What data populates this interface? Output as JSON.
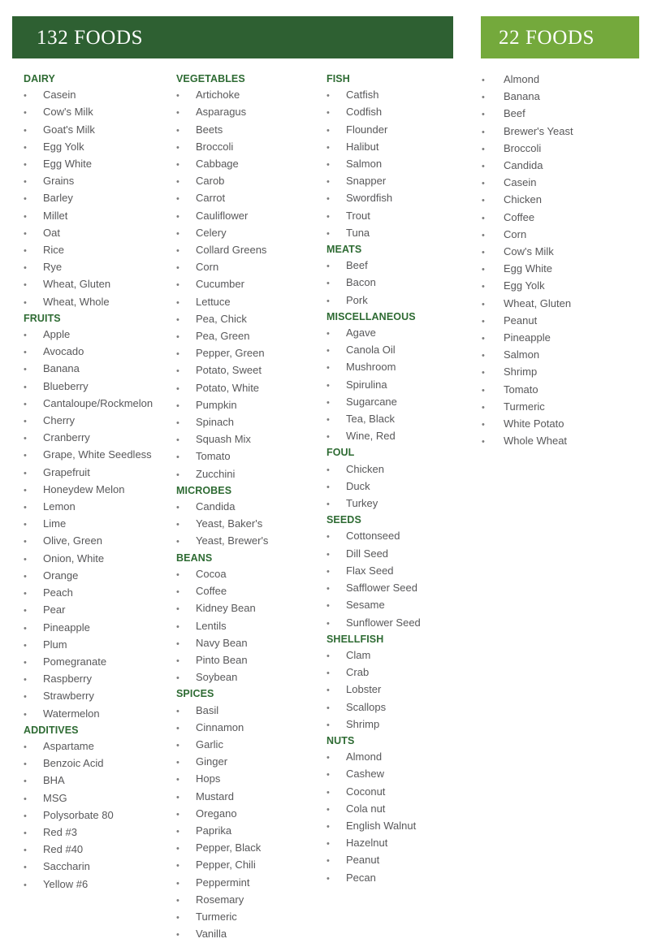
{
  "headers": {
    "primary": {
      "title": "132 FOODS",
      "color": "#2e6032"
    },
    "secondary": {
      "title": "22 FOODS",
      "color": "#74a93c"
    }
  },
  "bullet_glyph": "•",
  "heading_color": "#2e6b33",
  "item_color": "#58585a",
  "panel_132": {
    "columns": [
      {
        "sections": [
          {
            "heading": "DAIRY",
            "items": [
              "Casein",
              "Cow's Milk",
              "Goat's Milk",
              "Egg Yolk",
              "Egg White",
              "Grains",
              "Barley",
              "Millet",
              "Oat",
              "Rice",
              "Rye",
              "Wheat, Gluten",
              "Wheat, Whole"
            ]
          },
          {
            "heading": "FRUITS",
            "items": [
              "Apple",
              "Avocado",
              "Banana",
              "Blueberry",
              "Cantaloupe/Rockmelon",
              "Cherry",
              "Cranberry",
              "Grape, White Seedless",
              "Grapefruit",
              "Honeydew Melon",
              "Lemon",
              "Lime",
              "Olive, Green",
              "Onion, White",
              "Orange",
              "Peach",
              "Pear",
              "Pineapple",
              "Plum",
              "Pomegranate",
              "Raspberry",
              "Strawberry",
              "Watermelon"
            ]
          },
          {
            "heading": "ADDITIVES",
            "items": [
              "Aspartame",
              "Benzoic Acid",
              "BHA",
              "MSG",
              "Polysorbate 80",
              "Red #3",
              "Red #40",
              "Saccharin",
              "Yellow #6"
            ]
          }
        ]
      },
      {
        "sections": [
          {
            "heading": "VEGETABLES",
            "items": [
              "Artichoke",
              "Asparagus",
              "Beets",
              "Broccoli",
              "Cabbage",
              "Carob",
              "Carrot",
              "Cauliflower",
              "Celery",
              "Collard Greens",
              "Corn",
              "Cucumber",
              "Lettuce",
              "Pea, Chick",
              "Pea, Green",
              "Pepper, Green",
              "Potato, Sweet",
              "Potato, White",
              "Pumpkin",
              "Spinach",
              "Squash Mix",
              "Tomato",
              "Zucchini"
            ]
          },
          {
            "heading": "MICROBES",
            "items": [
              "Candida",
              "Yeast, Baker's",
              "Yeast, Brewer's"
            ]
          },
          {
            "heading": "BEANS",
            "items": [
              "Cocoa",
              "Coffee",
              "Kidney Bean",
              "Lentils",
              "Navy Bean",
              "Pinto Bean",
              "Soybean"
            ]
          },
          {
            "heading": "SPICES",
            "items": [
              "Basil",
              "Cinnamon",
              "Garlic",
              "Ginger",
              "Hops",
              "Mustard",
              "Oregano",
              "Paprika",
              "Pepper, Black",
              "Pepper, Chili",
              "Peppermint",
              "Rosemary",
              "Turmeric",
              "Vanilla"
            ]
          }
        ]
      },
      {
        "sections": [
          {
            "heading": "FISH",
            "items": [
              "Catfish",
              "Codfish",
              "Flounder",
              "Halibut",
              "Salmon",
              "Snapper",
              "Swordfish",
              "Trout",
              "Tuna"
            ]
          },
          {
            "heading": "MEATS",
            "items": [
              "Beef",
              "Bacon",
              "Pork"
            ]
          },
          {
            "heading": "MISCELLANEOUS",
            "items": [
              "Agave",
              "Canola Oil",
              "Mushroom",
              "Spirulina",
              "Sugarcane",
              "Tea, Black",
              "Wine, Red"
            ]
          },
          {
            "heading": "FOUL",
            "items": [
              "Chicken",
              "Duck",
              "Turkey"
            ]
          },
          {
            "heading": "SEEDS",
            "items": [
              "Cottonseed",
              "Dill Seed",
              "Flax Seed",
              "Safflower Seed",
              "Sesame",
              "Sunflower Seed"
            ]
          },
          {
            "heading": "SHELLFISH",
            "items": [
              "Clam",
              "Crab",
              "Lobster",
              "Scallops",
              "Shrimp"
            ]
          },
          {
            "heading": "NUTS",
            "items": [
              "Almond",
              "Cashew",
              "Coconut",
              "Cola nut",
              "English Walnut",
              "Hazelnut",
              "Peanut",
              "Pecan"
            ]
          }
        ]
      }
    ]
  },
  "panel_22": {
    "items": [
      "Almond",
      "Banana",
      "Beef",
      "Brewer's Yeast",
      "Broccoli",
      "Candida",
      "Casein",
      "Chicken",
      "Coffee",
      "Corn",
      "Cow's Milk",
      "Egg White",
      "Egg Yolk",
      "Wheat, Gluten",
      "Peanut",
      "Pineapple",
      "Salmon",
      "Shrimp",
      "Tomato",
      "Turmeric",
      "White Potato",
      "Whole Wheat"
    ]
  }
}
